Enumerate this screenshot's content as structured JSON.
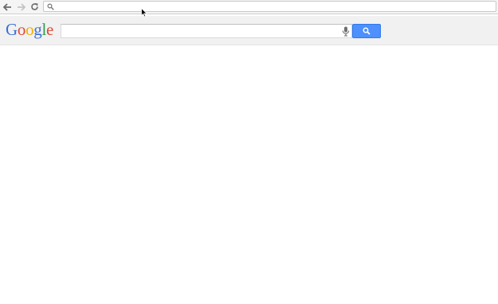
{
  "toolbar": {
    "back_icon": "arrow-left-icon",
    "forward_icon": "arrow-right-icon",
    "reload_icon": "reload-icon",
    "omnibox_value": "",
    "omnibox_icon": "search-icon"
  },
  "google": {
    "logo_letters": [
      "G",
      "o",
      "o",
      "g",
      "l",
      "e"
    ],
    "logo_colors": [
      "#3b6fd8",
      "#dd4b39",
      "#f2b000",
      "#3b6fd8",
      "#2d9b4a",
      "#dd4b39"
    ],
    "search_value": "",
    "mic_icon": "microphone-icon",
    "search_button_icon": "search-icon",
    "search_button_color": "#4d90fe"
  },
  "cursor_icon": "mouse-pointer-icon"
}
